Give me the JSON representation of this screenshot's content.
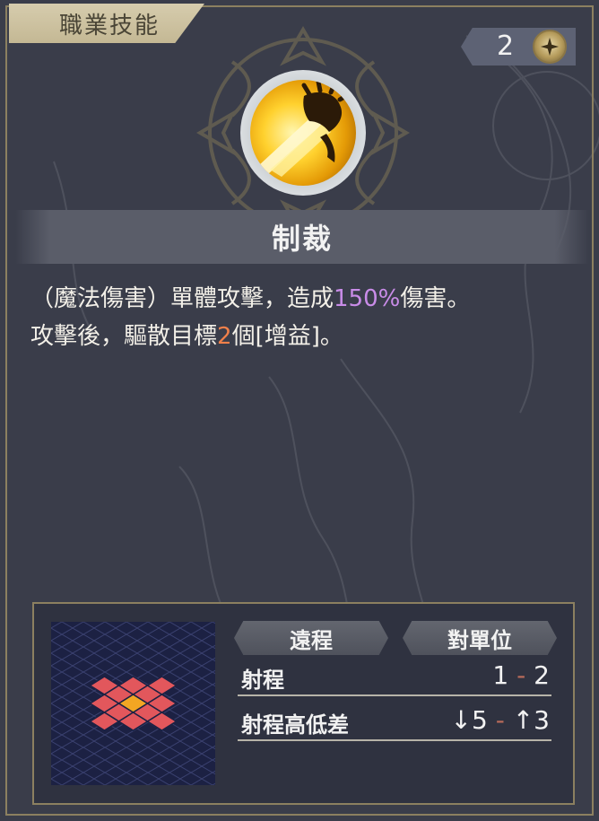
{
  "header": {
    "tab_label": "職業技能"
  },
  "cost": {
    "value": "2",
    "icon": "star-sparkle-icon"
  },
  "skill": {
    "icon": "golden-claw-strike-icon",
    "name": "制裁",
    "description_line1_prefix": "（魔法傷害）單體攻擊，造成",
    "description_line1_highlight": "150%",
    "description_line1_suffix": "傷害。",
    "description_line2_prefix": "攻擊後，驅散目標",
    "description_line2_highlight": "2",
    "description_line2_suffix": "個[增益]。"
  },
  "range_info": {
    "tag_type": "遠程",
    "tag_target": "對單位",
    "range_label": "射程",
    "range_min": "1",
    "range_sep": "-",
    "range_max": "2",
    "height_label": "射程高低差",
    "height_down": "↓5",
    "height_sep": "-",
    "height_up": "↑3"
  },
  "colors": {
    "highlight_percent": "#c98ce8",
    "highlight_number": "#f0804a",
    "attack_tile": "#e2575c",
    "center_tile": "#f2a623",
    "grid_background": "#1c2143"
  }
}
